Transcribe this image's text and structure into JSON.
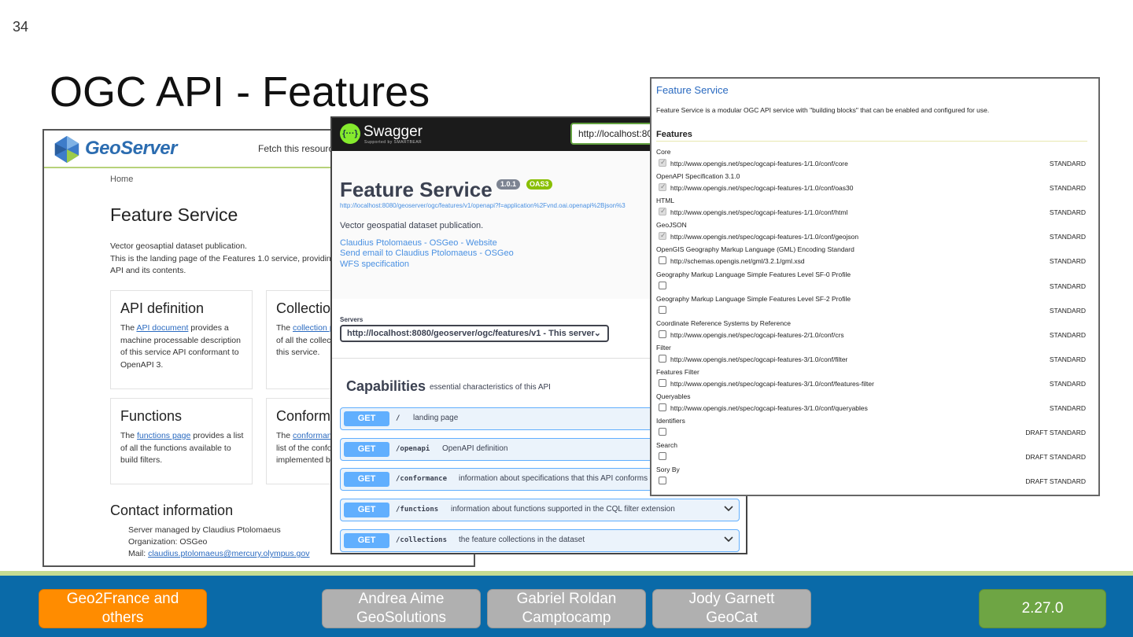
{
  "slide": {
    "page_number": "34",
    "title": "OGC API - Features"
  },
  "geoserver": {
    "brand": "GeoServer",
    "fetch_text": "Fetch this resource a",
    "breadcrumb": "Home",
    "heading": "Feature Service",
    "description_1": "Vector geosaptial dataset publication.",
    "description_2": "This is the landing page of the Features 1.0 service, providing",
    "description_3": "API and its contents.",
    "cards": [
      {
        "title": "API definition",
        "pre": "The ",
        "link": "API document",
        "post": " provides a machine processable description of this service API conformant to OpenAPI 3."
      },
      {
        "title": "Collection",
        "pre": "The ",
        "link": "collection p",
        "post": " of all the collect this service."
      },
      {
        "title": "Functions",
        "pre": "The ",
        "link": "functions page",
        "post": " provides a list of all the functions available to build filters."
      },
      {
        "title": "Conforma",
        "pre": "The ",
        "link": "conformanc",
        "post": " list of the confo implemented by"
      }
    ],
    "contact_heading": "Contact information",
    "contact_1": "Server managed by Claudius Ptolomaeus",
    "contact_2": "Organization: OSGeo",
    "contact_mail_label": "Mail: ",
    "contact_mail": "claudius.ptolomaeus@mercury.olympus.gov"
  },
  "swagger": {
    "brand": "Swagger",
    "brand_sub": "Supported by SMARTBEAR",
    "url": "http://localhost:808",
    "title": "Feature Service",
    "version": "1.0.1",
    "oas": "OAS3",
    "spec_url": "http://localhost:8080/geoserver/ogc/features/v1/openapi?f=application%2Fvnd.oai.openapi%2Bjson%3",
    "description": "Vector geospatial dataset publication.",
    "links": [
      "Claudius Ptolomaeus - OSGeo - Website",
      "Send email to Claudius Ptolomaeus - OSGeo",
      "WFS specification"
    ],
    "servers_label": "Servers",
    "server": "http://localhost:8080/geoserver/ogc/features/v1 - This server",
    "capabilities_title": "Capabilities",
    "capabilities_desc": "essential characteristics of this API",
    "ops": [
      {
        "method": "GET",
        "path": "/",
        "desc": "landing page"
      },
      {
        "method": "GET",
        "path": "/openapi",
        "desc": "OpenAPI definition"
      },
      {
        "method": "GET",
        "path": "/conformance",
        "desc": "information about specifications that this API conforms to"
      },
      {
        "method": "GET",
        "path": "/functions",
        "desc": "information about functions supported in the CQL filter extension"
      },
      {
        "method": "GET",
        "path": "/collections",
        "desc": "the feature collections in the dataset"
      }
    ]
  },
  "feature_service": {
    "title": "Feature Service",
    "description": "Feature Service is a modular OGC API service with \"building blocks\" that can be enabled and configured for use.",
    "features_heading": "Features",
    "rows": [
      {
        "name": "Core",
        "url": "http://www.opengis.net/spec/ogcapi-features-1/1.0/conf/core",
        "status": "STANDARD",
        "checked": true
      },
      {
        "name": "OpenAPI Specification 3.1.0",
        "url": "http://www.opengis.net/spec/ogcapi-features-1/1.0/conf/oas30",
        "status": "STANDARD",
        "checked": true
      },
      {
        "name": "HTML",
        "url": "http://www.opengis.net/spec/ogcapi-features-1/1.0/conf/html",
        "status": "STANDARD",
        "checked": true
      },
      {
        "name": "GeoJSON",
        "url": "http://www.opengis.net/spec/ogcapi-features-1/1.0/conf/geojson",
        "status": "STANDARD",
        "checked": true
      },
      {
        "name": "OpenGIS Geography Markup Language (GML) Encoding Standard",
        "url": "http://schemas.opengis.net/gml/3.2.1/gml.xsd",
        "status": "STANDARD",
        "checked": false
      },
      {
        "name": "Geography Markup Language Simple Features Level SF-0 Profile",
        "url": "",
        "status": "STANDARD",
        "checked": false
      },
      {
        "name": "Geography Markup Language Simple Features Level SF-2 Profile",
        "url": "",
        "status": "STANDARD",
        "checked": false
      },
      {
        "name": "Coordinate Reference Systems by Reference",
        "url": "http://www.opengis.net/spec/ogcapi-features-2/1.0/conf/crs",
        "status": "STANDARD",
        "checked": false
      },
      {
        "name": "Filter",
        "url": "http://www.opengis.net/spec/ogcapi-features-3/1.0/conf/filter",
        "status": "STANDARD",
        "checked": false
      },
      {
        "name": "Features Filter",
        "url": "http://www.opengis.net/spec/ogcapi-features-3/1.0/conf/features-filter",
        "status": "STANDARD",
        "checked": false
      },
      {
        "name": "Queryables",
        "url": "http://www.opengis.net/spec/ogcapi-features-3/1.0/conf/queryables",
        "status": "STANDARD",
        "checked": false
      },
      {
        "name": "Identifiers",
        "url": "",
        "status": "DRAFT STANDARD",
        "checked": false
      },
      {
        "name": "Search",
        "url": "",
        "status": "DRAFT STANDARD",
        "checked": false
      },
      {
        "name": "Sory By",
        "url": "",
        "status": "DRAFT STANDARD",
        "checked": false
      }
    ]
  },
  "footer": {
    "buttons": [
      {
        "line1": "Geo2France and",
        "line2": "others",
        "style": "orange"
      },
      {
        "line1": "Andrea Aime",
        "line2": "GeoSolutions",
        "style": "grey"
      },
      {
        "line1": "Gabriel Roldan",
        "line2": "Camptocamp",
        "style": "grey"
      },
      {
        "line1": "Jody Garnett",
        "line2": "GeoCat",
        "style": "grey"
      },
      {
        "line1": "2.27.0",
        "line2": "",
        "style": "green"
      }
    ]
  },
  "colors": {
    "footer_bar": "#0a6aa8",
    "orange": "#ff8c00",
    "grey": "#b0b0b0",
    "green": "#6ea544",
    "swagger_get": "#61affe"
  }
}
